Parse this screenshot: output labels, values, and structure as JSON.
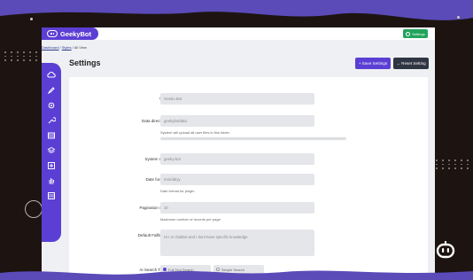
{
  "app": {
    "logo_text": "GeekyBot",
    "settings_label": "Settings",
    "breadcrumb": [
      "Dashboard",
      "/",
      "Styles",
      "/",
      "All View"
    ],
    "page_title": "Settings",
    "save_label": "+ Save Settings",
    "reset_label": "→ Reset Setting"
  },
  "sidebar": {
    "items": [
      {
        "icon": "cloud-icon"
      },
      {
        "icon": "pen-icon"
      },
      {
        "icon": "gear-icon"
      },
      {
        "icon": "wrench-icon"
      },
      {
        "icon": "table-icon"
      },
      {
        "icon": "layers-icon"
      },
      {
        "icon": "plus-box-icon"
      },
      {
        "icon": "hand-icon"
      },
      {
        "icon": "list-icon"
      }
    ]
  },
  "form": {
    "title": {
      "label": "Title",
      "value": "Geeko Bot"
    },
    "data_directory": {
      "label": "Data directory",
      "value": "geekybotdata",
      "help": "System will upload all user files in this folder"
    },
    "system_slug": {
      "label": "System slug",
      "value": "geeky-bot"
    },
    "date_format": {
      "label": "Date format",
      "value": "mm/dd/yy",
      "help": "Date format for plugin"
    },
    "pagination_size": {
      "label": "Pagination size",
      "value": "10",
      "help": "Maximum number of records per page"
    },
    "default_fallback": {
      "label": "Default Fallback",
      "value": "Hi I m chatbot and I dont have specific knowledge"
    },
    "ai_search_type": {
      "label": "AI Search Type",
      "options": [
        "Full Text Search",
        "Simple Search"
      ],
      "selected": "Full Text Search"
    }
  },
  "colors": {
    "accent": "#5b3fd4",
    "success": "#22a45d",
    "dark": "#2f3542",
    "background": "#1d1411"
  }
}
